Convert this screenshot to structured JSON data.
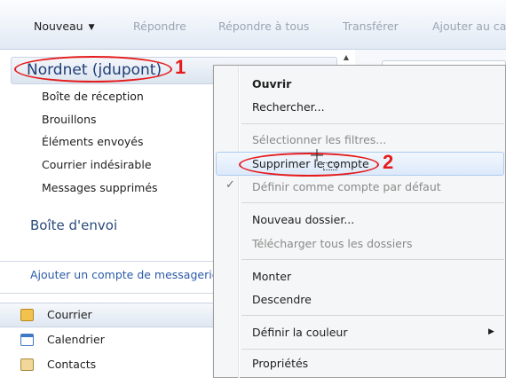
{
  "toolbar": {
    "new": "Nouveau",
    "reply": "Répondre",
    "reply_all": "Répondre à tous",
    "forward": "Transférer",
    "add": "Ajouter au ca"
  },
  "account": {
    "name": "Nordnet (jdupont)"
  },
  "folders": [
    "Boîte de réception",
    "Brouillons",
    "Éléments envoyés",
    "Courrier indésirable",
    "Messages supprimés"
  ],
  "outbox": "Boîte d'envoi",
  "add_account": "Ajouter un compte de messagerie",
  "nav": [
    {
      "label": "Courrier",
      "icon": "mail-icon"
    },
    {
      "label": "Calendrier",
      "icon": "calendar-icon"
    },
    {
      "label": "Contacts",
      "icon": "contacts-icon"
    }
  ],
  "context_menu": {
    "open": "Ouvrir",
    "search": "Rechercher...",
    "select_filters": "Sélectionner les filtres...",
    "delete_account": "Supprimer le compte",
    "set_default": "Définir comme compte par défaut",
    "new_folder": "Nouveau dossier...",
    "download_all": "Télécharger tous les dossiers",
    "move_up": "Monter",
    "move_down": "Descendre",
    "set_color": "Définir la couleur",
    "properties": "Propriétés"
  },
  "annotations": {
    "step1": "1",
    "step2": "2"
  },
  "colors": {
    "annotation": "#e51b1b",
    "account_title": "#1f3d77",
    "link": "#2b5aa8"
  }
}
